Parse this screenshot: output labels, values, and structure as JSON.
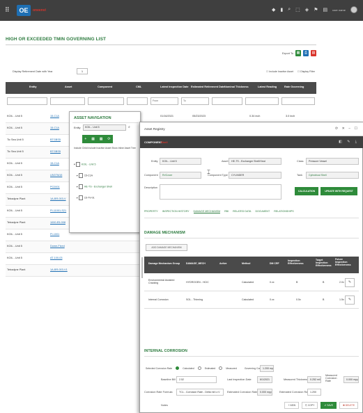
{
  "topbar": {
    "menu_glyph": "⠿",
    "logo": "OE",
    "logo_sub": "oneenvi",
    "icons": [
      "◆",
      "▮",
      "⌕",
      "⬚",
      "◈",
      "⚑",
      "▤"
    ],
    "user": "user name"
  },
  "page": {
    "title": "HIGH OR EXCEEDED TMIN GOVERNING LIST",
    "export_label": "Export To",
    "display_label": "Display Retirement Date with Year",
    "display_value": "1",
    "checks": [
      "Include Inactive Asset",
      "Display Filter"
    ]
  },
  "table": {
    "headers": [
      "Entity",
      "Asset",
      "Component",
      "CML",
      "Latest Inspection Date",
      "Estimated Retirement Date",
      "Nominal Thickness",
      "Latest Reading",
      "Rate Governing"
    ],
    "filters": [
      "",
      "",
      "",
      "",
      "From",
      "To",
      "",
      "",
      ""
    ],
    "rows": [
      [
        "KOIL - Unit 5",
        "15-C1A",
        "Channel - Cover",
        "1",
        "01/16/2021",
        "05/23/2023",
        "",
        "0.34 inch",
        "3.0 inch"
      ],
      [
        "KOIL - Unit 5",
        "15-C1A",
        "",
        "",
        "",
        "",
        "",
        "",
        ""
      ],
      [
        "Tic Sea Unit 5",
        "BTGBS5",
        "",
        "",
        "",
        "",
        "",
        "",
        ""
      ],
      [
        "Tic Sea Unit 5",
        "BTGBS5",
        "",
        "",
        "",
        "",
        "",
        "",
        ""
      ],
      [
        "KOIL - Unit 5",
        "15-C1A",
        "",
        "",
        "",
        "",
        "",
        "",
        ""
      ],
      [
        "KOIL - Unit 5",
        "LBGTM15",
        "",
        "",
        "",
        "",
        "",
        "",
        ""
      ],
      [
        "KOIL - Unit 5",
        "PC0001",
        "",
        "",
        "",
        "",
        "",
        "",
        ""
      ],
      [
        "Tetradyne Plant",
        "1A-BR-003-V",
        "",
        "",
        "",
        "",
        "",
        "",
        ""
      ],
      [
        "KOIL - Unit 5",
        "PI-11001-S21",
        "",
        "",
        "",
        "",
        "",
        "",
        ""
      ],
      [
        "Tetradyne Plant",
        "1000-E5-008",
        "",
        "",
        "",
        "",
        "",
        "",
        ""
      ],
      [
        "KOIL - Unit 5",
        "PI-1001",
        "",
        "",
        "",
        "",
        "",
        "",
        ""
      ],
      [
        "KOIL - Unit 5",
        "Dome-Fixed",
        "",
        "",
        "",
        "",
        "",
        "",
        ""
      ],
      [
        "KOIL - Unit 5",
        "AT-100-03",
        "",
        "",
        "",
        "",
        "",
        "",
        ""
      ],
      [
        "Tetradyne Plant",
        "1A-BR-003-V1",
        "",
        "",
        "",
        "",
        "",
        "",
        ""
      ]
    ]
  },
  "asset_popup": {
    "title": "ASSET NAVIGATION",
    "entity_label": "Entity",
    "entity_value": "KOIL - Unit 5",
    "btn_glyphs": [
      "+",
      "▦",
      "▦",
      "⟳"
    ],
    "options": "Include Child    Include Inactive Asset    Show Inline Asset Tree",
    "tree": [
      "KOIL - Unit 5",
      "15-C1A",
      "HE-TS - Exchanger Shell",
      "15-TV-01"
    ]
  },
  "record_popup": {
    "header": "Asset Registry",
    "header_ctrl": "⟳ ✕ − ☐",
    "bar_title": "COMPONENT",
    "bar_sub": "Shell",
    "bar_icons": "◧ ✎ ⤓",
    "fields": {
      "entity_label": "Entity",
      "entity_value": "KOIL - Unit 5",
      "asset_label": "Asset",
      "asset_value": "HE-TS - Exchanger Shell/Heat",
      "class_label": "Class",
      "class_value": "Pressure Vessel",
      "component_label": "Component",
      "component_value": "Rr/Cover",
      "comptype_label": "Component Type",
      "comptype_value": "CYLINDER",
      "tank_label": "Tank",
      "tank_value": "Cylindrical Shell",
      "desc_label": "Description",
      "desc_value": ""
    },
    "buttons": [
      "CALCULATION",
      "UPDATE WITH REQUEST"
    ],
    "tabs": [
      "PROPERTY",
      "INSPECTION HISTORY",
      "DAMAGE MECHANISM",
      "RBI",
      "RELATED DATA",
      "DOCUMENT",
      "RELATIONSHIPS"
    ],
    "dm_title": "DAMAGE MECHANISM",
    "add_btn": "ADD DAMAGE MECHANISM",
    "dm_headers": [
      "Damage Mechanism Group",
      "DAMAGE_MECH",
      "Active",
      "Method",
      "DM CRF",
      "Inspection Effectiveness",
      "Target Inspection Effectiveness",
      "Future Inspection Effectiveness"
    ],
    "dm_rows": [
      [
        "Environmental Assisted Cracking",
        "HYDROGEN - HCIC",
        "",
        "Calculated",
        "0.xx",
        "B",
        "B",
        "2.0x"
      ],
      [
        "Internal Corrosion",
        "SOL - Thinning",
        "",
        "Calculated",
        "0.xx",
        "0.5x",
        "B",
        "1.5x"
      ]
    ],
    "ic_title": "INTERNAL CORROSION",
    "ic_radio_label": "Selected Corrosion Rate",
    "ic_radios": [
      "Calculated",
      "Estimated",
      "Measured"
    ],
    "ic_gov_label": "Governing Corrosion Rate",
    "ic_gov_value": "1.200 mpy",
    "ic_row2": [
      "Baseline Bill",
      "2.52",
      "Last Inspection Date",
      "6/1/2021",
      "Measured Thickness",
      "0.252 mil",
      "Measured Corrosion Rate",
      "0.000 mpy"
    ],
    "ic_row3": [
      "Corrosion Rate Formula",
      "TCL - Corrosion Rate - Delta mil Lt.V",
      "Estimated Corrosion Rate",
      "0.000 mpy",
      "Estimated Corrosion Rate",
      "1.200"
    ],
    "ic_notes_label": "Notes",
    "foot_buttons": [
      "+ NEW",
      "⎘ COPY",
      "✔ SAVE",
      "✖ DELETE"
    ]
  }
}
